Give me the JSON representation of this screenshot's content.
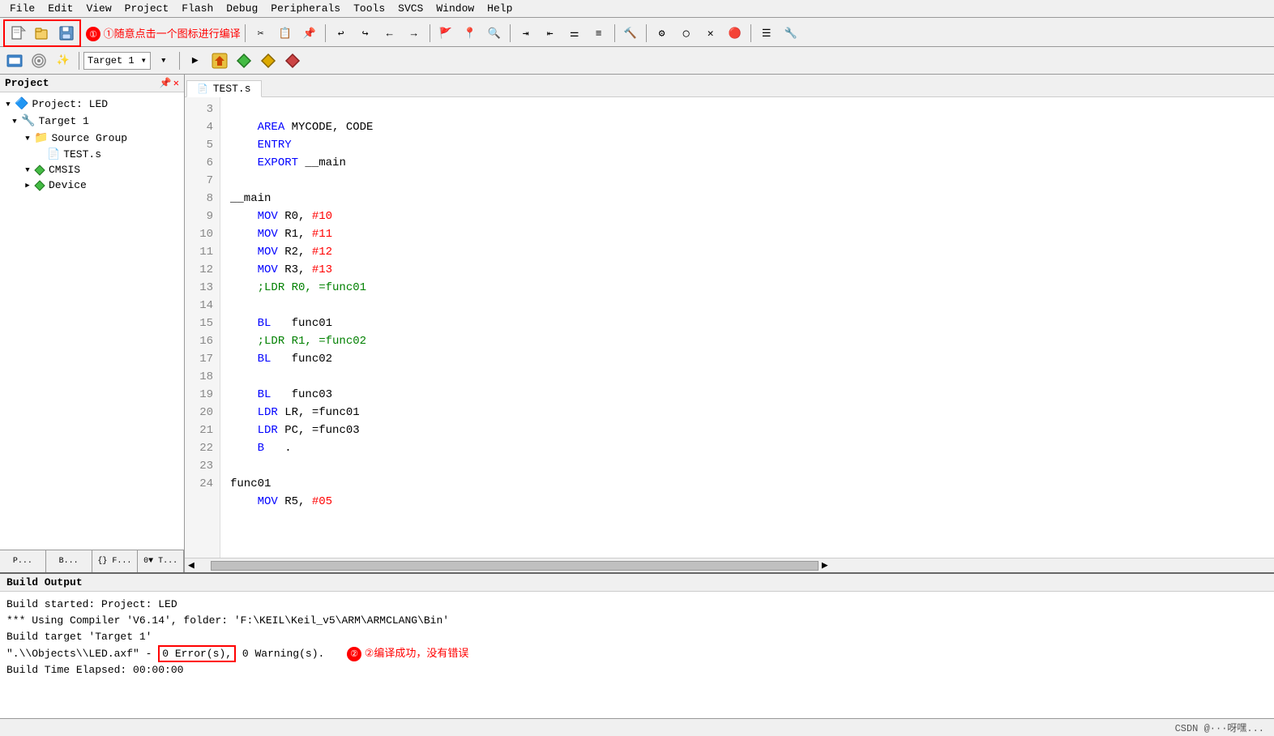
{
  "menubar": {
    "items": [
      "File",
      "Edit",
      "View",
      "Project",
      "Flash",
      "Debug",
      "Peripherals",
      "Tools",
      "SVCS",
      "Window",
      "Help"
    ]
  },
  "toolbar": {
    "target_dropdown": "Target 1"
  },
  "sidebar": {
    "title": "Project",
    "tree": {
      "project_label": "Project: LED",
      "target_label": "Target 1",
      "source_group_label": "Source Group",
      "test_file": "TEST.s",
      "cmsis_label": "CMSIS",
      "device_label": "Device"
    },
    "bottom_tabs": [
      "P...",
      "B...",
      "{} F...",
      "0▼ T..."
    ]
  },
  "editor": {
    "tab_label": "TEST.s",
    "lines": [
      {
        "num": "3",
        "code": "    AREA MYCODE, CODE",
        "parts": [
          {
            "text": "AREA ",
            "cls": "kw-blue"
          },
          {
            "text": "MYCODE, CODE",
            "cls": "kw-black"
          }
        ]
      },
      {
        "num": "4",
        "code": "    ENTRY",
        "parts": [
          {
            "text": "ENTRY",
            "cls": "kw-blue"
          }
        ]
      },
      {
        "num": "5",
        "code": "    EXPORT __main",
        "parts": [
          {
            "text": "EXPORT ",
            "cls": "kw-blue"
          },
          {
            "text": "__main",
            "cls": "kw-black"
          }
        ]
      },
      {
        "num": "6",
        "code": "",
        "parts": []
      },
      {
        "num": "7",
        "code": "__main",
        "parts": [
          {
            "text": "__main",
            "cls": "kw-black"
          }
        ]
      },
      {
        "num": "8",
        "code": "    MOV R0, #10",
        "parts": [
          {
            "text": "    MOV ",
            "cls": "kw-blue"
          },
          {
            "text": "R0, ",
            "cls": "kw-black"
          },
          {
            "text": "#10",
            "cls": "kw-red"
          }
        ]
      },
      {
        "num": "9",
        "code": "    MOV R1, #11",
        "parts": [
          {
            "text": "    MOV ",
            "cls": "kw-blue"
          },
          {
            "text": "R1, ",
            "cls": "kw-black"
          },
          {
            "text": "#11",
            "cls": "kw-red"
          }
        ]
      },
      {
        "num": "10",
        "code": "    MOV R2, #12",
        "parts": [
          {
            "text": "    MOV ",
            "cls": "kw-blue"
          },
          {
            "text": "R2, ",
            "cls": "kw-black"
          },
          {
            "text": "#12",
            "cls": "kw-red"
          }
        ]
      },
      {
        "num": "11",
        "code": "    MOV R3, #13",
        "parts": [
          {
            "text": "    MOV ",
            "cls": "kw-blue"
          },
          {
            "text": "R3, ",
            "cls": "kw-black"
          },
          {
            "text": "#13",
            "cls": "kw-red"
          }
        ]
      },
      {
        "num": "12",
        "code": "    ;LDR R0, =func01",
        "parts": [
          {
            "text": "    ;LDR R0, =func01",
            "cls": "kw-comment"
          }
        ]
      },
      {
        "num": "13",
        "code": "",
        "parts": []
      },
      {
        "num": "14",
        "code": "    BL   func01",
        "parts": [
          {
            "text": "    BL ",
            "cls": "kw-blue"
          },
          {
            "text": "  func01",
            "cls": "kw-black"
          }
        ]
      },
      {
        "num": "15",
        "code": "    ;LDR R1, =func02",
        "parts": [
          {
            "text": "    ;LDR R1, =func02",
            "cls": "kw-comment"
          }
        ]
      },
      {
        "num": "16",
        "code": "    BL   func02",
        "parts": [
          {
            "text": "    BL ",
            "cls": "kw-blue"
          },
          {
            "text": "  func02",
            "cls": "kw-black"
          }
        ]
      },
      {
        "num": "17",
        "code": "",
        "parts": []
      },
      {
        "num": "18",
        "code": "    BL   func03",
        "parts": [
          {
            "text": "    BL ",
            "cls": "kw-blue"
          },
          {
            "text": "  func03",
            "cls": "kw-black"
          }
        ]
      },
      {
        "num": "19",
        "code": "    LDR LR, =func01",
        "parts": [
          {
            "text": "    LDR ",
            "cls": "kw-blue"
          },
          {
            "text": "LR, =func01",
            "cls": "kw-black"
          }
        ]
      },
      {
        "num": "20",
        "code": "    LDR PC, =func03",
        "parts": [
          {
            "text": "    LDR ",
            "cls": "kw-blue"
          },
          {
            "text": "PC, =func03",
            "cls": "kw-black"
          }
        ]
      },
      {
        "num": "21",
        "code": "    B   .",
        "parts": [
          {
            "text": "    B ",
            "cls": "kw-blue"
          },
          {
            "text": "  .",
            "cls": "kw-black"
          }
        ]
      },
      {
        "num": "22",
        "code": "",
        "parts": []
      },
      {
        "num": "23",
        "code": "func01",
        "parts": [
          {
            "text": "func01",
            "cls": "kw-black"
          }
        ]
      },
      {
        "num": "24",
        "code": "    MOV R5, #05",
        "parts": [
          {
            "text": "    MOV ",
            "cls": "kw-blue"
          },
          {
            "text": "R5, ",
            "cls": "kw-black"
          },
          {
            "text": "#05",
            "cls": "kw-red"
          }
        ]
      }
    ]
  },
  "build_output": {
    "title": "Build Output",
    "lines": [
      "Build started: Project: LED",
      "*** Using Compiler 'V6.14', folder: 'F:\\KEIL\\Keil_v5\\ARM\\ARMCLANG\\Bin'",
      "Build target 'Target 1'",
      "\".\\Objects\\LED.axf\" -  0 Error(s),  0 Warning(s).",
      "Build Time Elapsed:   00:00:00"
    ],
    "error_highlight": "0 Error(s),"
  },
  "annotations": {
    "ann1_text": "①随意点击一个图标进行编译",
    "ann2_text": "②编译成功，没有错误"
  },
  "status_bar": {
    "right_text": "CSDN @···呀嘿..."
  }
}
